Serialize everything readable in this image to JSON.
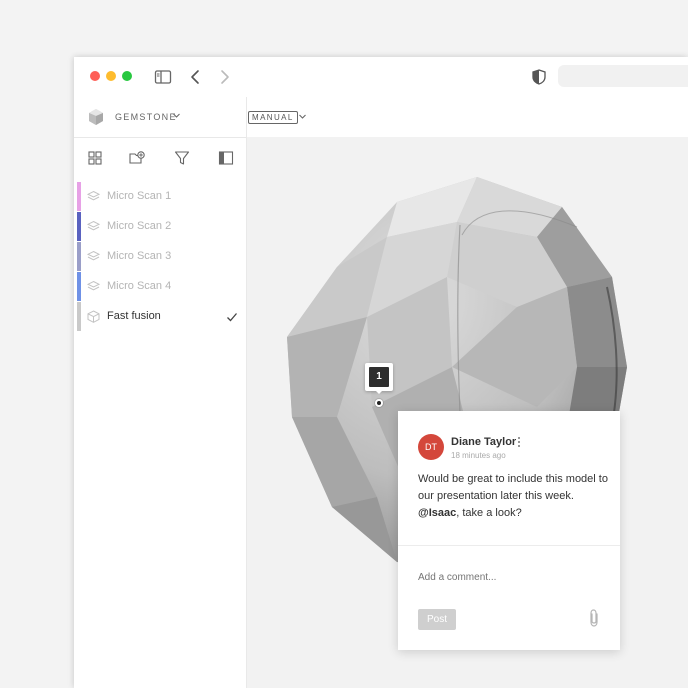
{
  "window": {
    "controls": [
      "close",
      "minimize",
      "maximize"
    ],
    "toolbar_icons": [
      "sidebar-toggle-icon",
      "chevron-left-icon",
      "chevron-right-icon",
      "shield-icon"
    ],
    "url": ""
  },
  "sidebar": {
    "project": {
      "name": "GEMSTONE",
      "icon": "gem-icon"
    },
    "tools": [
      "grid-icon",
      "add-folder-icon",
      "filter-icon",
      "panel-icon"
    ],
    "layers": [
      {
        "label": "Micro Scan 1",
        "color": "#e7a1e6",
        "active": false
      },
      {
        "label": "Micro Scan 2",
        "color": "#5a62c0",
        "active": false
      },
      {
        "label": "Micro Scan 3",
        "color": "#9a9ec8",
        "active": false
      },
      {
        "label": "Micro Scan 4",
        "color": "#6f91e6",
        "active": false
      },
      {
        "label": "Fast fusion",
        "color": "#c9c9c9",
        "active": true
      }
    ]
  },
  "content": {
    "mode": "MANUAL",
    "annotation": {
      "number": "1"
    }
  },
  "comment": {
    "initials": "DT",
    "avatar_color": "#d4473b",
    "author": "Diane Taylor",
    "time": "18 minutes ago",
    "text_before": "Would be great to include this model to our presentation later this week.",
    "mention": "@Isaac",
    "text_after": ", take a look?",
    "input_placeholder": "Add a comment...",
    "post_label": "Post"
  }
}
